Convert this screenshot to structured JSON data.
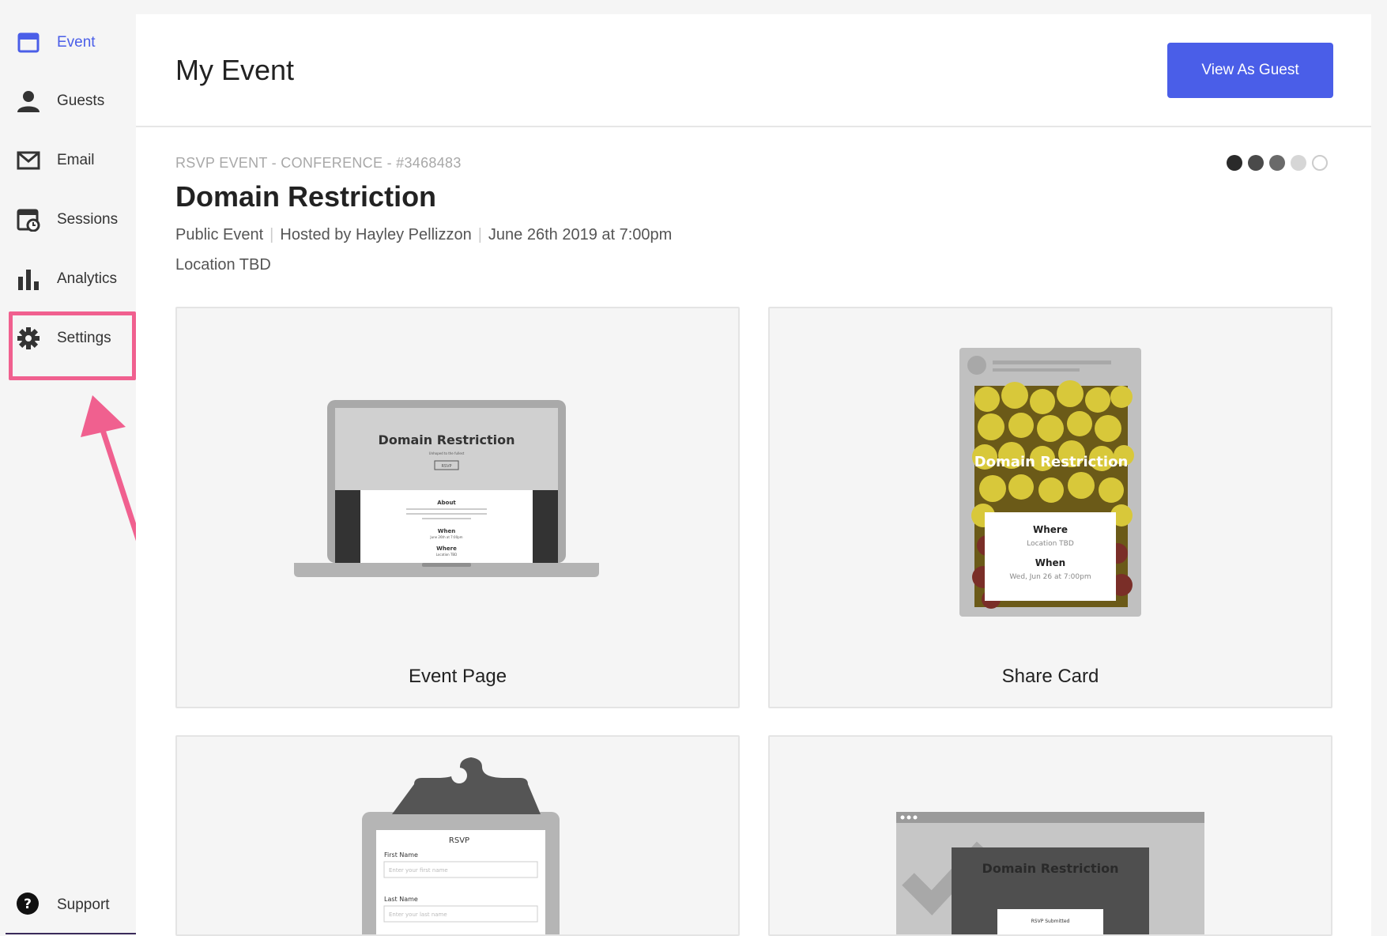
{
  "sidebar": {
    "items": [
      {
        "label": "Event",
        "icon": "calendar-window-icon",
        "active": true
      },
      {
        "label": "Guests",
        "icon": "person-icon"
      },
      {
        "label": "Email",
        "icon": "envelope-icon"
      },
      {
        "label": "Sessions",
        "icon": "sessions-icon"
      },
      {
        "label": "Analytics",
        "icon": "bar-chart-icon"
      },
      {
        "label": "Settings",
        "icon": "gear-icon"
      }
    ],
    "support": {
      "label": "Support",
      "icon": "help-circle-icon"
    }
  },
  "header": {
    "title": "My Event",
    "view_as_guest": "View As Guest"
  },
  "event": {
    "meta": "RSVP EVENT - CONFERENCE - #3468483",
    "title": "Domain Restriction",
    "visibility": "Public Event",
    "host": "Hosted by Hayley Pellizzon",
    "date": "June 26th 2019 at 7:00pm",
    "location": "Location TBD"
  },
  "progress_dots": {
    "filled": 3,
    "total": 5
  },
  "cards": [
    {
      "label": "Event Page",
      "preview": {
        "title": "Domain Restriction",
        "subtitle": "Unhoped to the fullest",
        "button": "RSVP",
        "about": "About",
        "when": "When",
        "when_value": "June 26th at 7:00pm",
        "where": "Where",
        "where_value": "Location TBD"
      }
    },
    {
      "label": "Share Card",
      "preview": {
        "title": "Domain Restriction",
        "where": "Where",
        "where_value": "Location TBD",
        "when": "When",
        "when_value": "Wed, Jun 26 at 7:00pm"
      }
    },
    {
      "label": "",
      "preview": {
        "title": "RSVP",
        "first_name": "First Name",
        "first_placeholder": "Enter your first name",
        "last_name": "Last Name",
        "last_placeholder": "Enter your last name"
      }
    },
    {
      "label": "",
      "preview": {
        "title": "Domain Restriction",
        "status": "RSVP Submitted"
      }
    }
  ],
  "colors": {
    "accent": "#4a5ee8",
    "highlight": "#f0608f",
    "text": "#222222",
    "muted": "#a8a8a8"
  }
}
